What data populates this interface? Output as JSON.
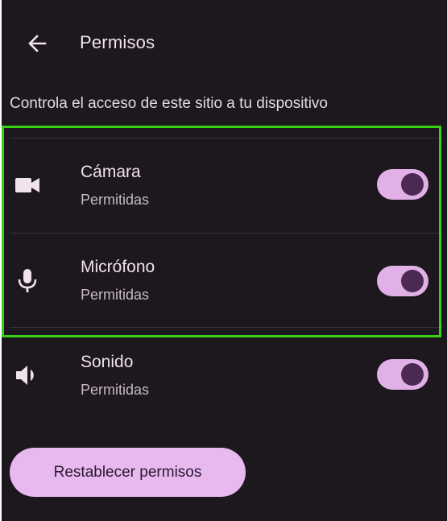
{
  "header": {
    "back_icon": "arrow-left-icon",
    "title": "Permisos"
  },
  "description": "Controla el acceso de este sitio a tu dispositivo",
  "permissions": [
    {
      "name": "Cámara",
      "state": "Permitidas",
      "icon": "camera-icon",
      "enabled": true
    },
    {
      "name": "Micrófono",
      "state": "Permitidas",
      "icon": "microphone-icon",
      "enabled": true
    },
    {
      "name": "Sonido",
      "state": "Permitidas",
      "icon": "speaker-icon",
      "enabled": true
    }
  ],
  "reset_button": "Restablecer permisos",
  "colors": {
    "background": "#1d181d",
    "toggle_track": "#e0b0e6",
    "toggle_knob": "#4a2a52",
    "button": "#e7b9ef",
    "highlight": "#39d017"
  }
}
